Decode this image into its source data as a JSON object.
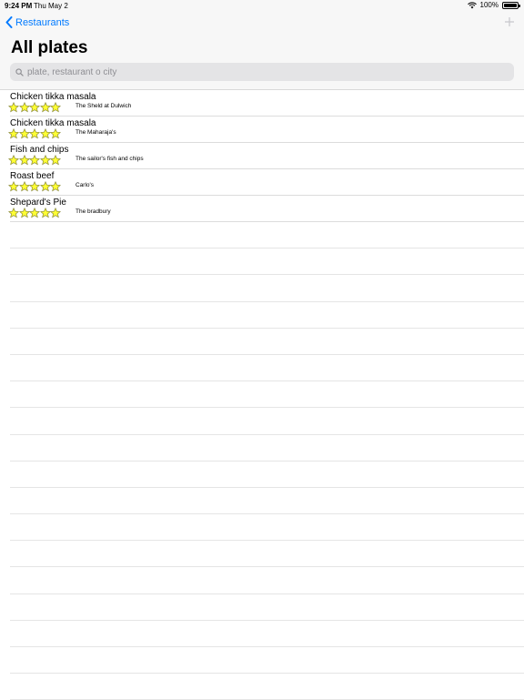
{
  "status_bar": {
    "time": "9:24 PM",
    "date": "Thu May 2",
    "battery_text": "100%",
    "battery_level": 1.0
  },
  "nav": {
    "back_label": "Restaurants"
  },
  "header": {
    "title": "All plates"
  },
  "search": {
    "placeholder": "plate, restaurant o city"
  },
  "plates": [
    {
      "name": "Chicken tikka masala",
      "restaurant": "The Sheld at Dulwich",
      "rating": 5
    },
    {
      "name": "Chicken tikka masala",
      "restaurant": "The Maharaja's",
      "rating": 5
    },
    {
      "name": "Fish and chips",
      "restaurant": "The sailor's fish and chips",
      "rating": 5
    },
    {
      "name": "Roast beef",
      "restaurant": "Carlo's",
      "rating": 5
    },
    {
      "name": "Shepard's Pie",
      "restaurant": "The bradbury",
      "rating": 5
    }
  ],
  "colors": {
    "accent": "#007aff",
    "star_fill": "#ffff33",
    "star_stroke": "#8a8a3a"
  }
}
